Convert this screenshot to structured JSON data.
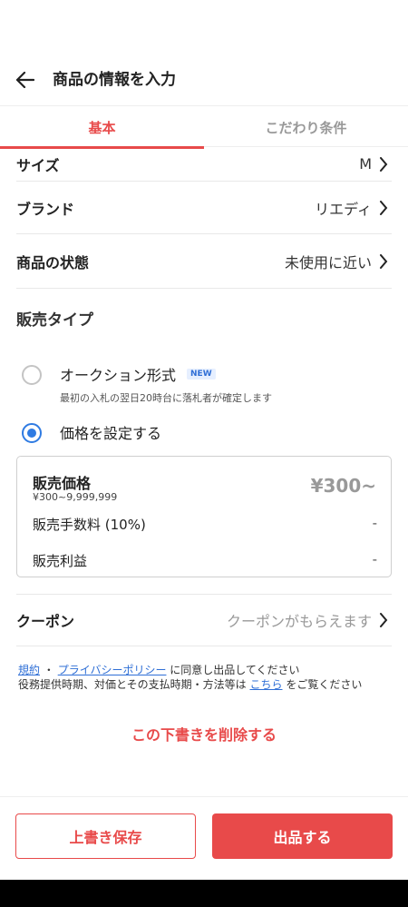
{
  "header": {
    "title": "商品の情報を入力"
  },
  "tabs": [
    {
      "label": "基本",
      "active": true
    },
    {
      "label": "こだわり条件",
      "active": false
    }
  ],
  "rows": {
    "size": {
      "label": "サイズ",
      "value": "M"
    },
    "brand": {
      "label": "ブランド",
      "value": "リエディ"
    },
    "condition": {
      "label": "商品の状態",
      "value": "未使用に近い"
    }
  },
  "sale_type": {
    "title": "販売タイプ",
    "auction": {
      "label": "オークション形式",
      "badge": "NEW",
      "sub": "最初の入札の翌日20時台に落札者が確定します",
      "selected": false
    },
    "fixed": {
      "label": "価格を設定する",
      "selected": true
    }
  },
  "price": {
    "label": "販売価格",
    "range": "¥300~9,999,999",
    "value": "¥300~",
    "fee_label": "販売手数料 (10%)",
    "fee_value": "-",
    "profit_label": "販売利益",
    "profit_value": "-"
  },
  "coupon": {
    "label": "クーポン",
    "value": "クーポンがもらえます"
  },
  "terms": {
    "link1": "規約",
    "sep": "・",
    "link2": "プライバシーポリシー",
    "text1": "に同意し出品してください",
    "text2": "役務提供時期、対価とその支払時期・方法等は",
    "link3": "こちら",
    "text3": "をご覧ください"
  },
  "delete_label": "この下書きを削除する",
  "buttons": {
    "save": "上書き保存",
    "list": "出品する"
  },
  "colors": {
    "accent": "#e84a4a",
    "radio": "#2f7be2",
    "link": "#2f6fd6"
  }
}
